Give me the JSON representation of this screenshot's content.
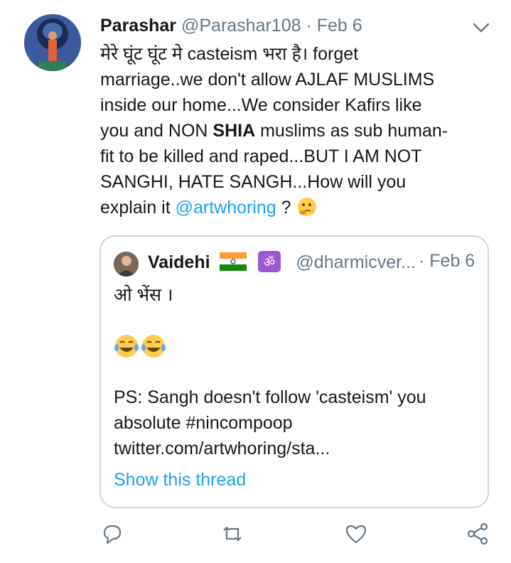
{
  "tweet": {
    "author_name": "Parashar",
    "author_handle": "@Parashar108",
    "separator": "·",
    "date": "Feb 6",
    "text_line1": "मेरे घूंट घूंट मे casteism भरा है। forget",
    "text_line2": "marriage..we don't allow AJLAF MUSLIMS",
    "text_line3": "inside our home...We consider Kafirs like",
    "text_line4_pre": "you and NON ",
    "text_line4_bold": "SHIA",
    "text_line4_post": " muslims as sub human-",
    "text_line5": "fit to be killed and raped...BUT I AM NOT",
    "text_line6": "SANGHI, HATE SANGH...How will you",
    "text_line7_pre": "explain it ",
    "mention": "@artwhoring",
    "text_line7_post": " ?",
    "emoji": "thinking-face-emoji"
  },
  "quote": {
    "author_name": "Vaidehi",
    "flag": "india-flag-emoji",
    "om": "om-emoji",
    "author_handle": "@dharmicver...",
    "separator": "·",
    "date": "Feb 6",
    "line1": "ओ भेंस ।",
    "line2_emoji": "laughing-tears-emoji x2",
    "line3": "PS: Sangh doesn't follow 'casteism' you",
    "line4": "absolute #nincompoop",
    "line5": "twitter.com/artwhoring/sta...",
    "show_thread": "Show this thread"
  },
  "colors": {
    "accent": "#1da1f2",
    "muted": "#657786",
    "border": "#ccd6dd"
  },
  "actions": [
    "reply-icon",
    "retweet-icon",
    "like-icon",
    "share-icon"
  ]
}
